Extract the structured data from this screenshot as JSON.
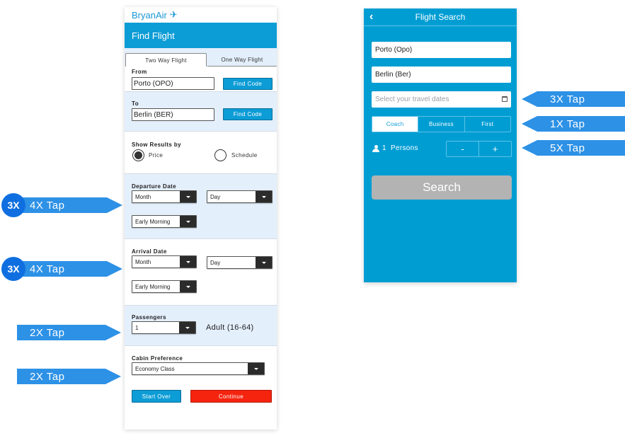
{
  "left_app": {
    "brand": "BryanAir",
    "brand_icon": "airplane-icon",
    "header_title": "Find Flight",
    "tabs": [
      {
        "label": "Two Way Flight",
        "active": true
      },
      {
        "label": "One Way Flight",
        "active": false
      }
    ],
    "from": {
      "label": "From",
      "value": "Porto (OPO)",
      "button": "Find Code"
    },
    "to": {
      "label": "To",
      "value": "Berlin (BER)",
      "button": "Find Code"
    },
    "show_results": {
      "label": "Show Results by",
      "options": [
        {
          "label": "Price",
          "selected": true
        },
        {
          "label": "Schedule",
          "selected": false
        }
      ]
    },
    "departure": {
      "label": "Departure Date",
      "month": "Month",
      "day": "Day",
      "time": "Early Morning"
    },
    "arrival": {
      "label": "Arrival Date",
      "month": "Month",
      "day": "Day",
      "time": "Early Morning"
    },
    "passengers": {
      "label": "Passengers",
      "value": "1",
      "type": "Adult (16-64)"
    },
    "cabin": {
      "label": "Cabin Preference",
      "value": "Economy Class"
    },
    "buttons": {
      "start_over": "Start Over",
      "continue": "Continue"
    }
  },
  "right_app": {
    "header_title": "Flight Search",
    "back_icon": "chevron-left-icon",
    "from_value": "Porto (Opo)",
    "to_value": "Berlin (Ber)",
    "dates_placeholder": "Select your travel dates",
    "classes": [
      {
        "label": "Coach",
        "active": true
      },
      {
        "label": "Business",
        "active": false
      },
      {
        "label": "First",
        "active": false
      }
    ],
    "persons_count": "1",
    "persons_label": "Persons",
    "minus": "-",
    "plus": "+",
    "search_button": "Search"
  },
  "annotations": {
    "left": [
      {
        "badge": "3X",
        "text": "4X Tap"
      },
      {
        "badge": "3X",
        "text": "4X Tap"
      },
      {
        "text": "2X Tap"
      },
      {
        "text": "2X Tap"
      }
    ],
    "right": [
      {
        "text": "3X Tap"
      },
      {
        "text": "1X Tap"
      },
      {
        "text": "5X Tap"
      }
    ]
  },
  "colors": {
    "primary": "#0c9cd6",
    "panel_blue": "#e4effc",
    "continue_red": "#f5240f",
    "search_disabled": "#b3b3b3",
    "annotation_blue": "#2d91e6",
    "badge_blue": "#0f6fe0"
  }
}
